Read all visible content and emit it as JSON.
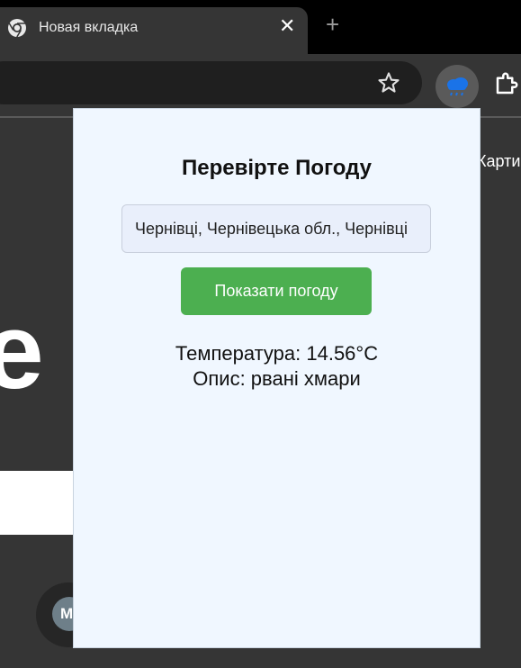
{
  "browser": {
    "tab": {
      "title": "Новая вкладка",
      "close": "✕"
    },
    "new_tab": "+",
    "colors": {
      "frame": "#000000",
      "toolbar": "#353535",
      "omnibox": "#1f1f1f"
    }
  },
  "background_page": {
    "large_letter": "e",
    "side_text": "Карти",
    "shortcut_initial": "M"
  },
  "popup": {
    "title": "Перевірте Погоду",
    "city_input_value": "Чернівці, Чернівецька обл., Чернівці",
    "button_label": "Показати погоду",
    "temperature_line": "Температура: 14.56°C",
    "description_line": "Опис: рвані хмари",
    "colors": {
      "background": "#f0f7ff",
      "button": "#4caf50"
    }
  }
}
